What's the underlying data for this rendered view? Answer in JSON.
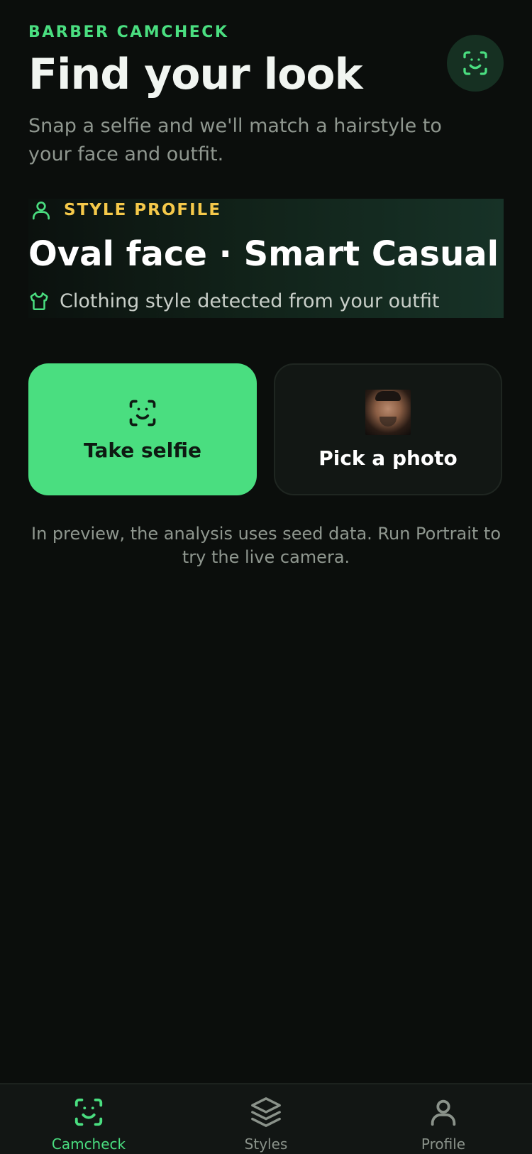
{
  "header": {
    "eyebrow": "BARBER CAMCHECK",
    "title": "Find your look",
    "subtitle": "Snap a selfie and we'll match a hairstyle to your face and outfit.",
    "avatar_icon": "face-scan-icon"
  },
  "style_profile": {
    "eyebrow": "STYLE PROFILE",
    "eyebrow_icon": "user-icon",
    "title": "Oval face · Smart Casual",
    "detail": "Clothing style detected from your outfit",
    "detail_icon": "shirt-icon"
  },
  "actions": {
    "take_selfie": {
      "label": "Take selfie",
      "icon": "face-scan-icon"
    },
    "pick_photo": {
      "label": "Pick a photo",
      "thumbnail": "portrait-photo"
    }
  },
  "notice": "In preview, the analysis uses seed data. Run Portrait to try the live camera.",
  "tabs": [
    {
      "label": "Camcheck",
      "icon": "face-scan-icon",
      "active": true
    },
    {
      "label": "Styles",
      "icon": "layers-icon",
      "active": false
    },
    {
      "label": "Profile",
      "icon": "user-icon",
      "active": false
    }
  ],
  "colors": {
    "accent": "#4ade80",
    "highlight": "#f5c94a",
    "background": "#0b0e0c",
    "muted_text": "#8f978f"
  }
}
